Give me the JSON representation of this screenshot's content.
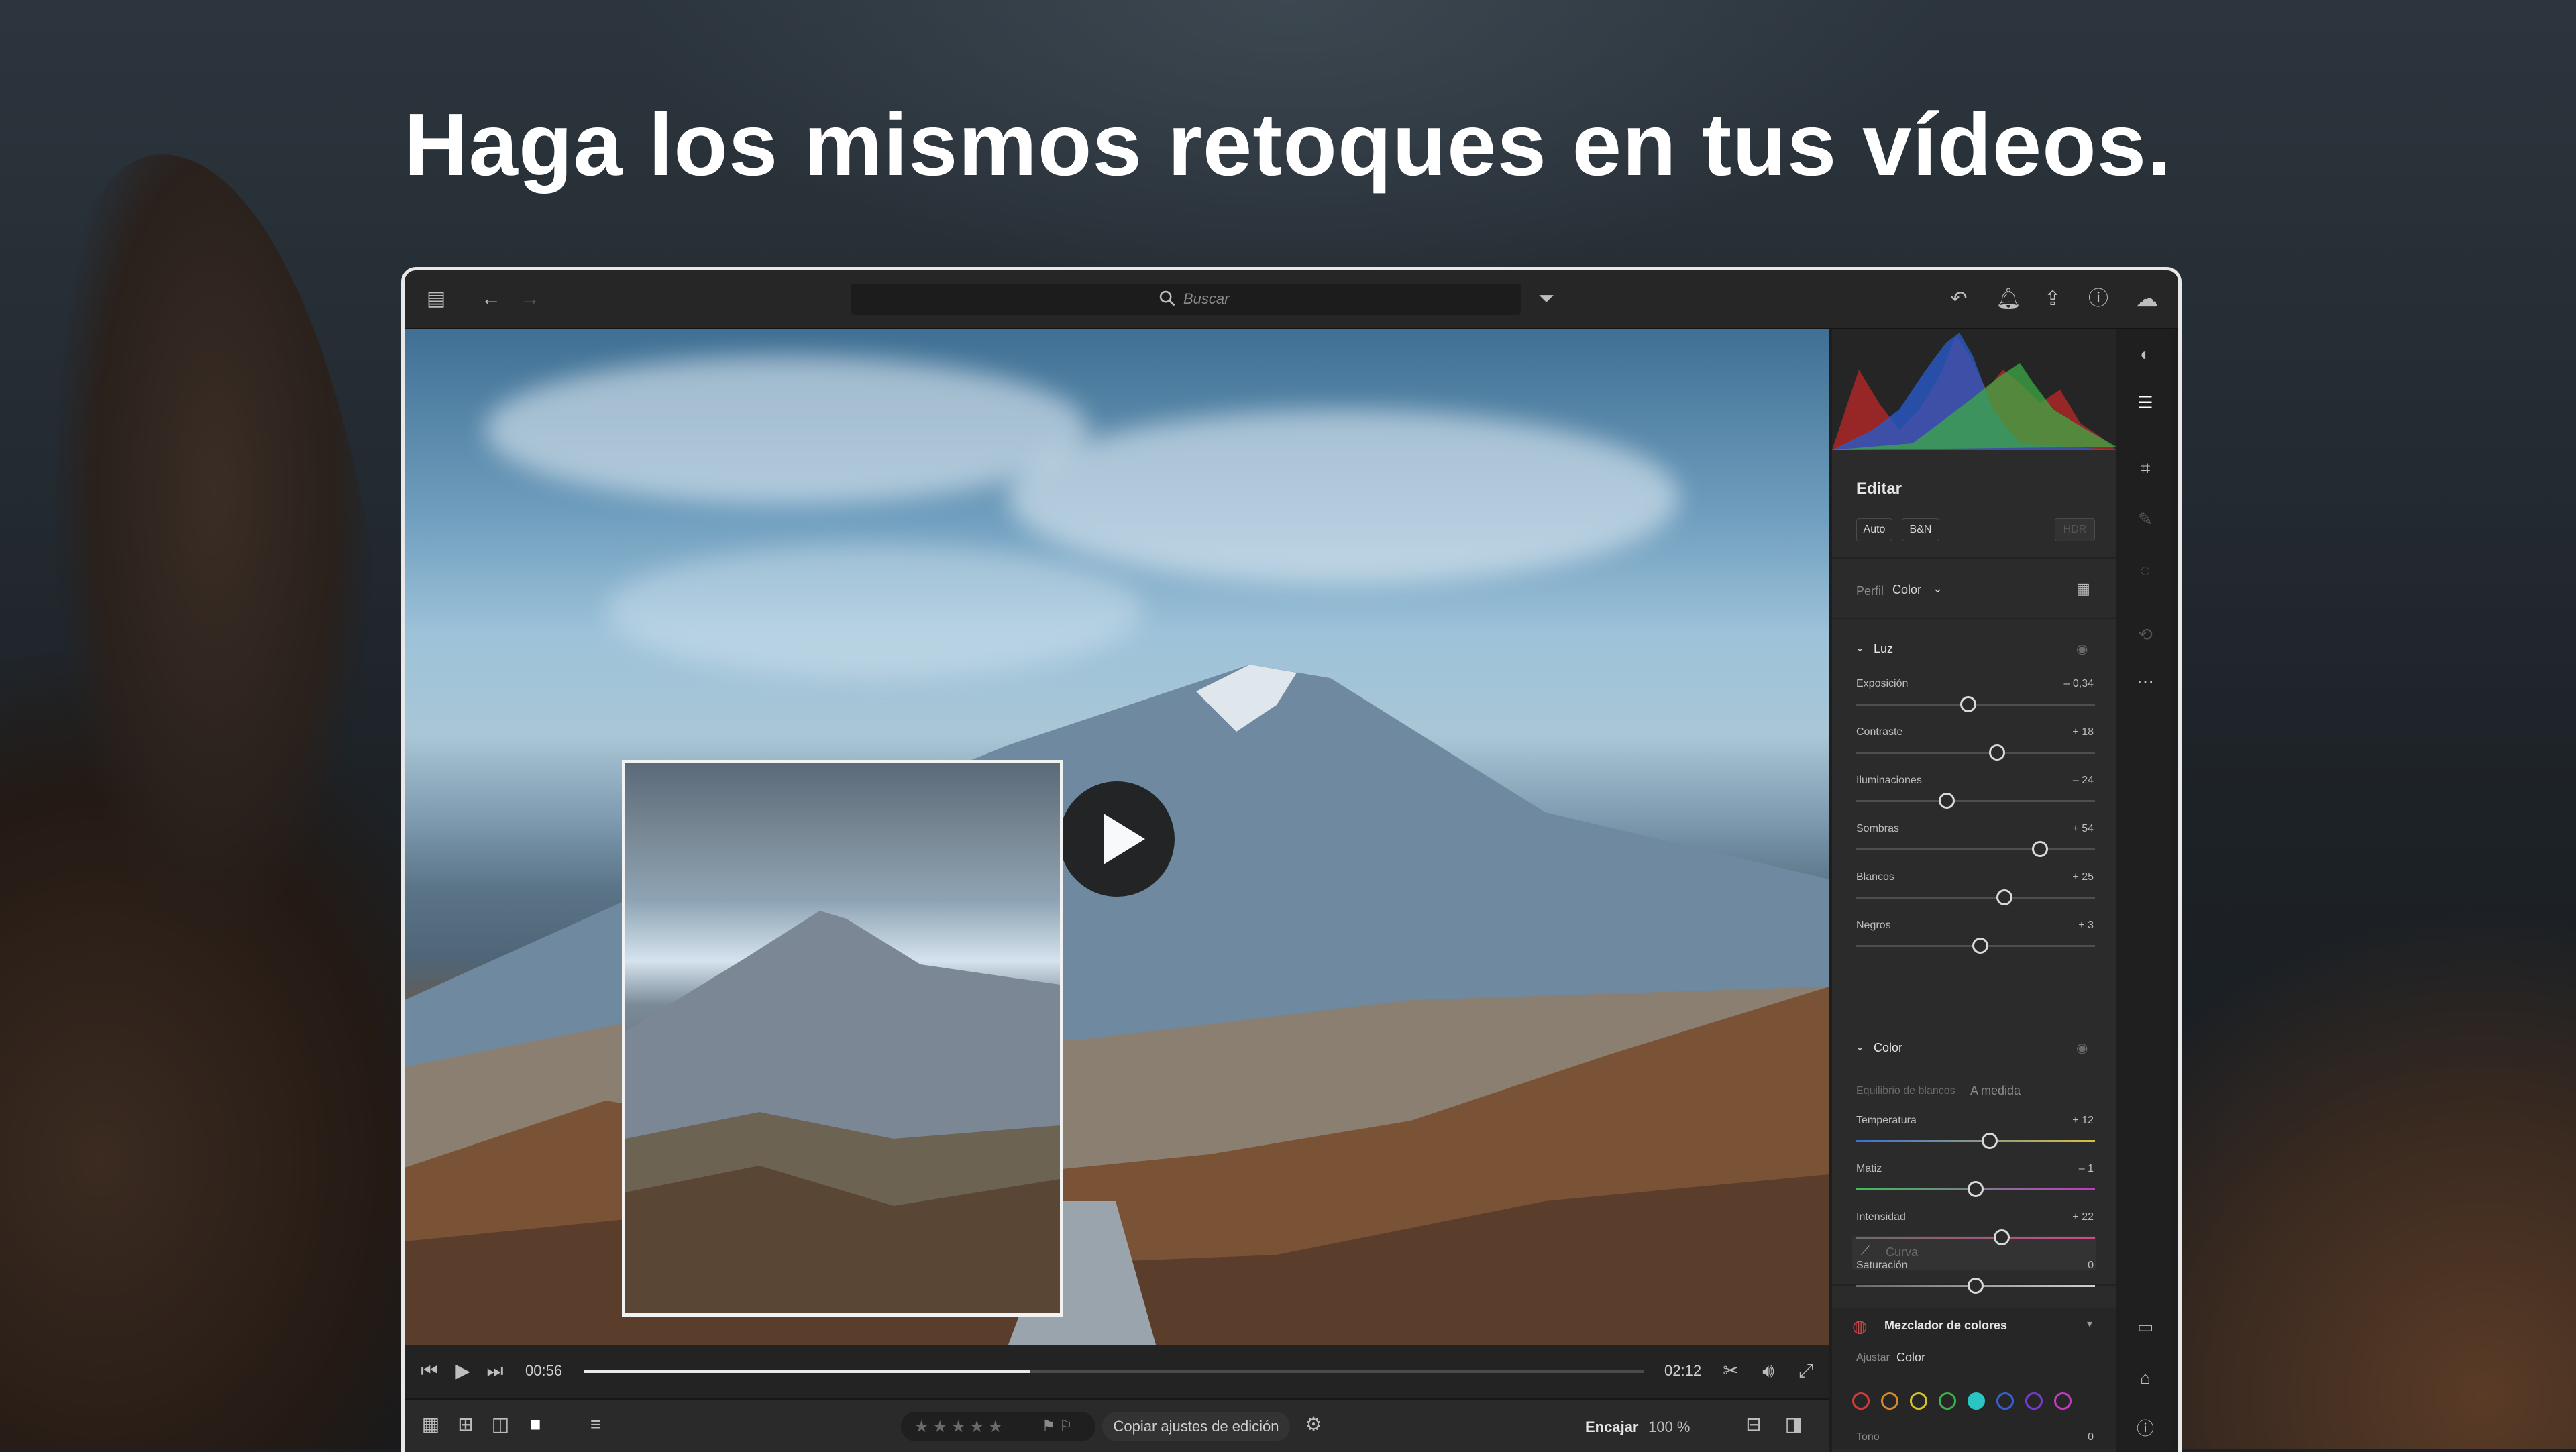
{
  "headline": "Haga los mismos retoques en tus vídeos.",
  "search": {
    "placeholder": "Buscar"
  },
  "player": {
    "current_time": "00:56",
    "total_time": "02:12",
    "progress": 0.42
  },
  "bottombar": {
    "copy_label": "Copiar ajustes de edición",
    "fit_label": "Encajar",
    "zoom": "100 %"
  },
  "panel": {
    "title": "Editar",
    "auto_button": "Auto",
    "bw_button": "B&N",
    "hdr_button": "HDR",
    "profile_label": "Perfil",
    "profile_value": "Color",
    "light": {
      "section": "Luz",
      "sliders": [
        {
          "label": "Exposición",
          "value": "– 0,34",
          "pos": 0.47
        },
        {
          "label": "Contraste",
          "value": "+ 18",
          "pos": 0.59
        },
        {
          "label": "Iluminaciones",
          "value": "– 24",
          "pos": 0.38
        },
        {
          "label": "Sombras",
          "value": "+ 54",
          "pos": 0.77
        },
        {
          "label": "Blancos",
          "value": "+ 25",
          "pos": 0.62
        },
        {
          "label": "Negros",
          "value": "+ 3",
          "pos": 0.52
        }
      ],
      "curve_label": "Curva"
    },
    "color": {
      "section": "Color",
      "wb_label": "Equilibrio de blancos",
      "wb_value": "A medida",
      "sliders": [
        {
          "label": "Temperatura",
          "value": "+ 12",
          "pos": 0.56
        },
        {
          "label": "Matiz",
          "value": "– 1",
          "pos": 0.5
        },
        {
          "label": "Intensidad",
          "value": "+ 22",
          "pos": 0.61
        },
        {
          "label": "Saturación",
          "value": "0",
          "pos": 0.5
        }
      ]
    },
    "mixer": {
      "title": "Mezclador de colores",
      "adjust_label": "Ajustar",
      "adjust_value": "Color",
      "tone_label": "Tono",
      "tone_value": "0",
      "dots": [
        "#d43b3b",
        "#d48a2b",
        "#d4c42b",
        "#3bb34a",
        "#2bc4c4",
        "#3b5fd4",
        "#7a3bd4",
        "#c43bc4"
      ]
    }
  }
}
